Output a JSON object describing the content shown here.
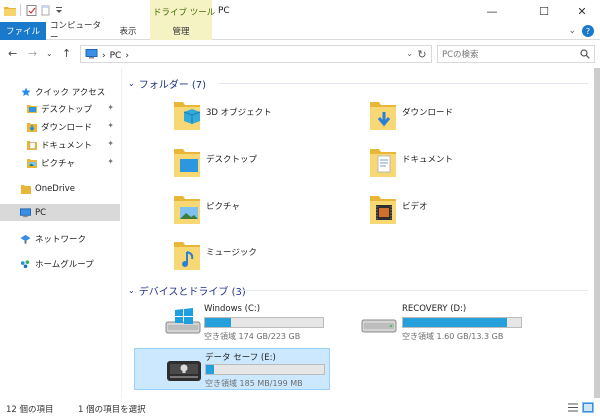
{
  "titlebar": {
    "context_tab_header": "ドライブ ツール",
    "window_title": "PC",
    "minimize": "—",
    "maximize": "☐",
    "close": "✕"
  },
  "ribbon": {
    "tabs": [
      {
        "label": "ファイル"
      },
      {
        "label": "コンピューター"
      },
      {
        "label": "表示"
      },
      {
        "label": "管理"
      }
    ],
    "collapse_glyph": "⌄",
    "help_glyph": "?"
  },
  "addressbar": {
    "back_glyph": "←",
    "forward_glyph": "→",
    "recent_glyph": "⌄",
    "up_glyph": "↑",
    "breadcrumb_root": "PC",
    "breadcrumb_sep": "›",
    "dropdown_glyph": "⌄",
    "refresh_glyph": "↻",
    "search_placeholder": "PCの検索"
  },
  "navpane": {
    "quick_access": "クイック アクセス",
    "quick_items": [
      {
        "label": "デスクトップ",
        "icon": "desktop-folder-icon"
      },
      {
        "label": "ダウンロード",
        "icon": "downloads-folder-icon"
      },
      {
        "label": "ドキュメント",
        "icon": "documents-folder-icon"
      },
      {
        "label": "ピクチャ",
        "icon": "pictures-folder-icon"
      }
    ],
    "pin_glyph": "📌",
    "onedrive": "OneDrive",
    "pc": "PC",
    "network": "ネットワーク",
    "homegroup": "ホームグループ"
  },
  "content": {
    "folders_header": "フォルダー (7)",
    "folders": [
      {
        "label": "3D オブジェクト",
        "icon": "3d-objects-folder-icon"
      },
      {
        "label": "ダウンロード",
        "icon": "downloads-folder-icon"
      },
      {
        "label": "デスクトップ",
        "icon": "desktop-folder-icon"
      },
      {
        "label": "ドキュメント",
        "icon": "documents-folder-icon"
      },
      {
        "label": "ピクチャ",
        "icon": "pictures-folder-icon"
      },
      {
        "label": "ビデオ",
        "icon": "videos-folder-icon"
      },
      {
        "label": "ミュージック",
        "icon": "music-folder-icon"
      }
    ],
    "drives_header": "デバイスとドライブ (3)",
    "drives": [
      {
        "label": "Windows (C:)",
        "free": "空き領域 174 GB/223 GB",
        "used_fraction": 0.22,
        "icon": "windows-drive-icon"
      },
      {
        "label": "RECOVERY (D:)",
        "free": "空き領域 1.60 GB/13.3 GB",
        "used_fraction": 0.88,
        "icon": "hdd-drive-icon"
      },
      {
        "label": "データ セーフ (E:)",
        "free": "空き領域 185 MB/199 MB",
        "used_fraction": 0.07,
        "icon": "secure-drive-icon",
        "selected": true
      }
    ]
  },
  "statusbar": {
    "item_count": "12 個の項目",
    "selected_count": "1 個の項目を選択"
  },
  "colors": {
    "accent": "#1979ca",
    "drive_bar": "#26a0da",
    "selection": "#cce8ff",
    "group_header": "#1e3287",
    "context_tab": "#f5f2c4"
  }
}
